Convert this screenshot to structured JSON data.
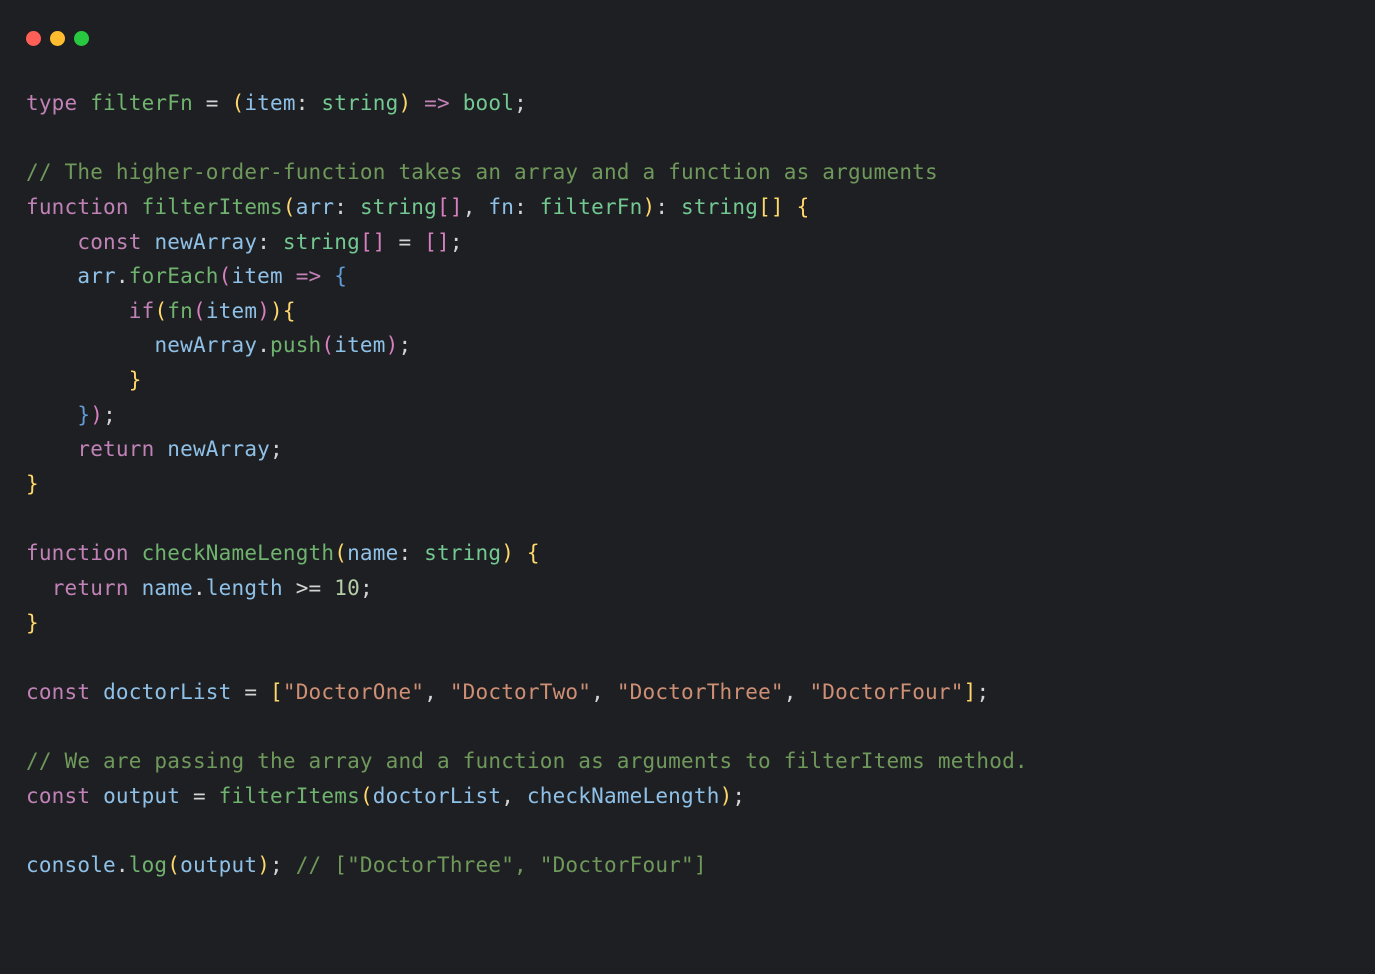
{
  "traffic_lights": [
    "red",
    "yellow",
    "green"
  ],
  "code": {
    "l1": {
      "type_kw": "type",
      "name": "filterFn",
      "eq": " = ",
      "lp": "(",
      "param": "item",
      "colon": ": ",
      "ptype": "string",
      "rp": ")",
      "arrow": " => ",
      "ret": "bool",
      "semi": ";"
    },
    "l2_blank": "",
    "l3": {
      "comment": "// The higher-order-function takes an array and a function as arguments"
    },
    "l4": {
      "fn_kw": "function",
      "name": "filterItems",
      "lp": "(",
      "p1": "arr",
      "c1": ": ",
      "t1": "string",
      "br1": "[]",
      "comma": ", ",
      "p2": "fn",
      "c2": ": ",
      "t2": "filterFn",
      "rp": ")",
      "c3": ": ",
      "rt": "string",
      "br2": "[]",
      "sp": " ",
      "lb": "{"
    },
    "l5": {
      "indent": "    ",
      "const_kw": "const",
      "name": "newArray",
      "colon": ": ",
      "type": "string",
      "br": "[]",
      "eq": " = ",
      "lb": "[",
      "rb": "]",
      "semi": ";"
    },
    "l6": {
      "indent": "    ",
      "obj": "arr",
      "dot": ".",
      "method": "forEach",
      "lp": "(",
      "param": "item",
      "arrow": " => ",
      "lb": "{"
    },
    "l7": {
      "indent": "        ",
      "if_kw": "if",
      "lp": "(",
      "fn": "fn",
      "lp2": "(",
      "arg": "item",
      "rp2": ")",
      "rp": ")",
      "lb": "{"
    },
    "l8": {
      "indent": "          ",
      "obj": "newArray",
      "dot": ".",
      "method": "push",
      "lp": "(",
      "arg": "item",
      "rp": ")",
      "semi": ";"
    },
    "l9": {
      "indent": "        ",
      "rb": "}"
    },
    "l10": {
      "indent": "    ",
      "rb": "}",
      "rp": ")",
      "semi": ";"
    },
    "l11": {
      "indent": "    ",
      "return_kw": "return",
      "name": "newArray",
      "semi": ";"
    },
    "l12": {
      "rb": "}"
    },
    "l13_blank": "",
    "l14": {
      "fn_kw": "function",
      "name": "checkNameLength",
      "lp": "(",
      "param": "name",
      "colon": ": ",
      "ptype": "string",
      "rp": ")",
      "sp": " ",
      "lb": "{"
    },
    "l15": {
      "indent": "  ",
      "return_kw": "return",
      "obj": "name",
      "dot": ".",
      "prop": "length",
      "op": " >= ",
      "num": "10",
      "semi": ";"
    },
    "l16": {
      "rb": "}"
    },
    "l17_blank": "",
    "l18": {
      "const_kw": "const",
      "name": "doctorList",
      "eq": " = ",
      "lb": "[",
      "s1": "\"DoctorOne\"",
      "c1": ", ",
      "s2": "\"DoctorTwo\"",
      "c2": ", ",
      "s3": "\"DoctorThree\"",
      "c3": ", ",
      "s4": "\"DoctorFour\"",
      "rb": "]",
      "semi": ";"
    },
    "l19_blank": "",
    "l20": {
      "comment": "// We are passing the array and a function as arguments to filterItems method."
    },
    "l21": {
      "const_kw": "const",
      "name": "output",
      "eq": " = ",
      "fn": "filterItems",
      "lp": "(",
      "a1": "doctorList",
      "comma": ", ",
      "a2": "checkNameLength",
      "rp": ")",
      "semi": ";"
    },
    "l22_blank": "",
    "l23": {
      "obj": "console",
      "dot": ".",
      "method": "log",
      "lp": "(",
      "arg": "output",
      "rp": ")",
      "semi": ";",
      "sp": " ",
      "comment": "// [\"DoctorThree\", \"DoctorFour\"]"
    }
  }
}
